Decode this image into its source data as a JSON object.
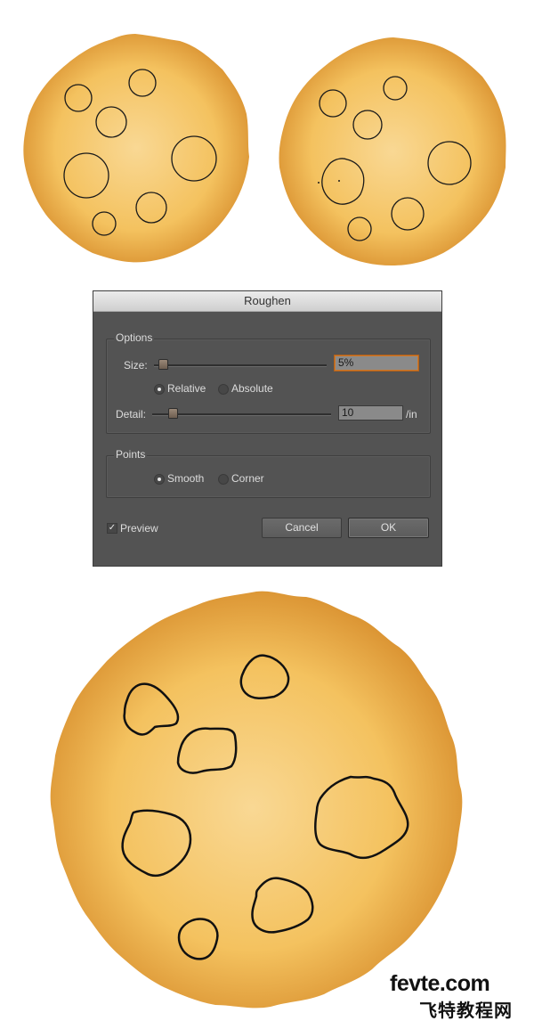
{
  "dialog": {
    "title": "Roughen",
    "options": {
      "group_label": "Options",
      "size_label": "Size:",
      "size_value": "5%",
      "size_slider_fraction": 0.05,
      "relative_label": "Relative",
      "absolute_label": "Absolute",
      "selected_mode": "relative",
      "detail_label": "Detail:",
      "detail_value": "10",
      "detail_unit": "/in",
      "detail_slider_fraction": 0.1
    },
    "points": {
      "group_label": "Points",
      "smooth_label": "Smooth",
      "corner_label": "Corner",
      "selected_point": "smooth"
    },
    "preview_label": "Preview",
    "preview_checked": true,
    "cancel_label": "Cancel",
    "ok_label": "OK"
  },
  "watermark": {
    "latin": "fevte.com",
    "cjk": "飞特教程网"
  },
  "colors": {
    "cookie_center": "#f9d894",
    "cookie_mid": "#f4c25f",
    "cookie_edge": "#d88f2e",
    "dialog_bg": "#535353",
    "focus_ring": "#d07a2a"
  }
}
